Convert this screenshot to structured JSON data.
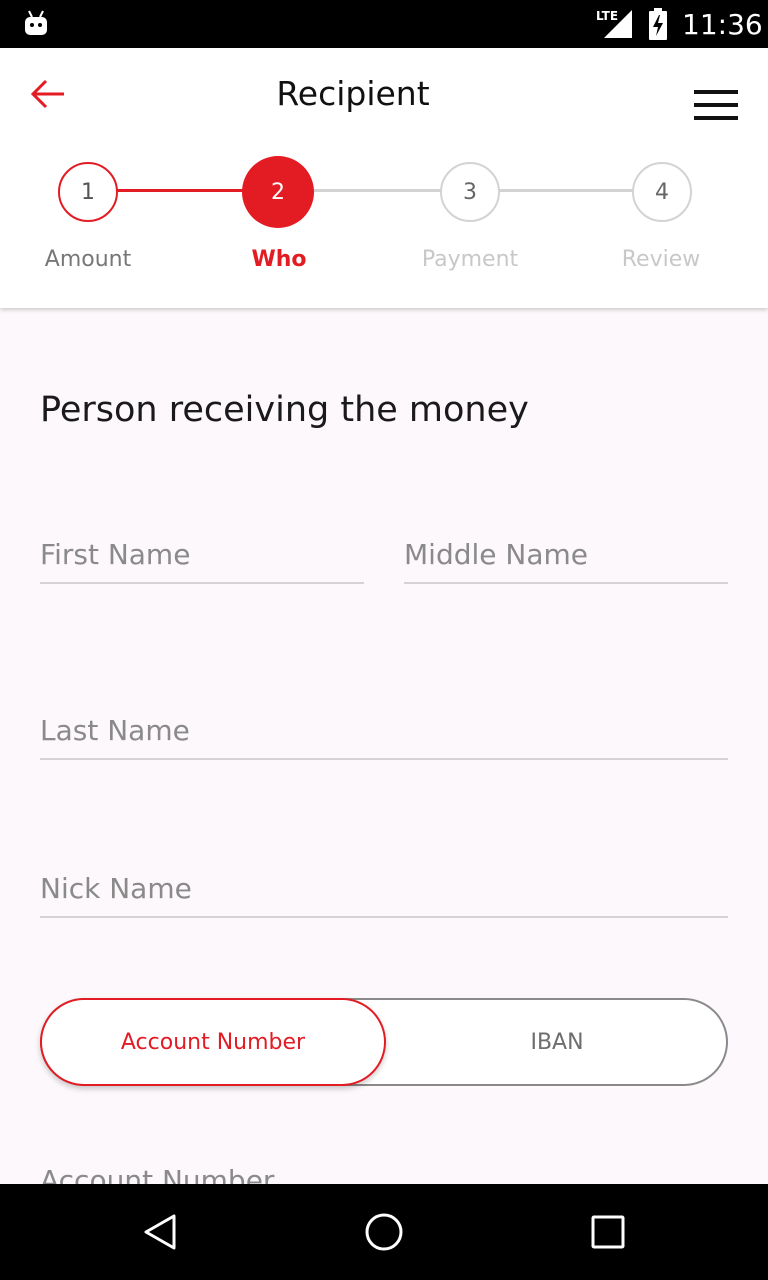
{
  "status_bar": {
    "network": "LTE",
    "time": "11:36",
    "icons": [
      "android-icon",
      "signal-icon",
      "battery-charging-icon"
    ]
  },
  "header": {
    "title": "Recipient",
    "back_icon": "arrow-left-icon",
    "menu_icon": "hamburger-menu-icon"
  },
  "stepper": {
    "steps": [
      {
        "number": "1",
        "label": "Amount",
        "state": "completed"
      },
      {
        "number": "2",
        "label": "Who",
        "state": "active"
      },
      {
        "number": "3",
        "label": "Payment",
        "state": "upcoming"
      },
      {
        "number": "4",
        "label": "Review",
        "state": "upcoming"
      }
    ]
  },
  "form": {
    "section_title": "Person receiving the money",
    "first_name": {
      "placeholder": "First Name",
      "value": ""
    },
    "middle_name": {
      "placeholder": "Middle Name",
      "value": ""
    },
    "last_name": {
      "placeholder": "Last Name",
      "value": ""
    },
    "nick_name": {
      "placeholder": "Nick Name",
      "value": ""
    },
    "account_type": {
      "options": [
        "Account Number",
        "IBAN"
      ],
      "selected": "Account Number"
    },
    "account_number": {
      "placeholder": "Account Number"
    }
  },
  "nav_bar": {
    "icons": [
      "back-triangle-icon",
      "home-circle-icon",
      "recents-square-icon"
    ]
  },
  "colors": {
    "accent": "#e31b23",
    "inactive": "#cfcfcf",
    "background": "#fcf8fb"
  }
}
